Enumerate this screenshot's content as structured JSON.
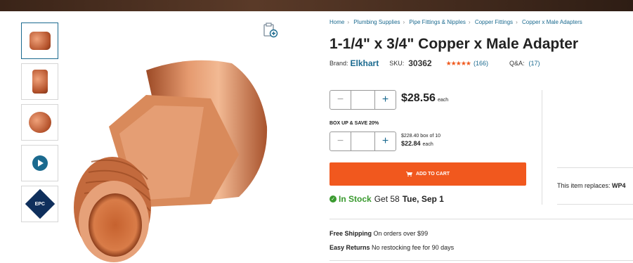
{
  "breadcrumb": [
    "Home",
    "Plumbing Supplies",
    "Pipe Fittings & Nipples",
    "Copper Fittings",
    "Copper x Male Adapters"
  ],
  "product": {
    "title": "1-1/4\" x 3/4\" Copper x Male Adapter",
    "brand_label": "Brand:",
    "brand": "Elkhart",
    "sku_label": "SKU:",
    "sku": "30362",
    "stars": "★★★★★",
    "rating_count": "(166)",
    "qa_label": "Q&A:",
    "qa_count": "(17)"
  },
  "pricing": {
    "price": "$28.56",
    "each": "each",
    "box_label": "BOX UP & SAVE 20%",
    "box_total": "$228.40 box of 10",
    "box_each_price": "$22.84",
    "box_each": "each"
  },
  "cart": {
    "label": "ADD TO CART"
  },
  "stock": {
    "status": "In Stock",
    "get": "Get 58",
    "date": "Tue, Sep 1"
  },
  "perks": [
    {
      "title": "Free Shipping",
      "text": "On orders over $99"
    },
    {
      "title": "Easy Returns",
      "text": "No restocking fee for 90 days"
    }
  ],
  "replaces": {
    "label": "This item replaces:",
    "value": "WP4"
  },
  "thumbs": {
    "epc_text": "EPC"
  },
  "colors": {
    "accent": "#1b6a8f",
    "cta": "#f1581e",
    "instock": "#3a9a2f",
    "star": "#f05a1e"
  },
  "icons": [
    "compare-icon",
    "play-icon",
    "cart-icon",
    "check-icon",
    "plus-icon",
    "minus-icon"
  ]
}
